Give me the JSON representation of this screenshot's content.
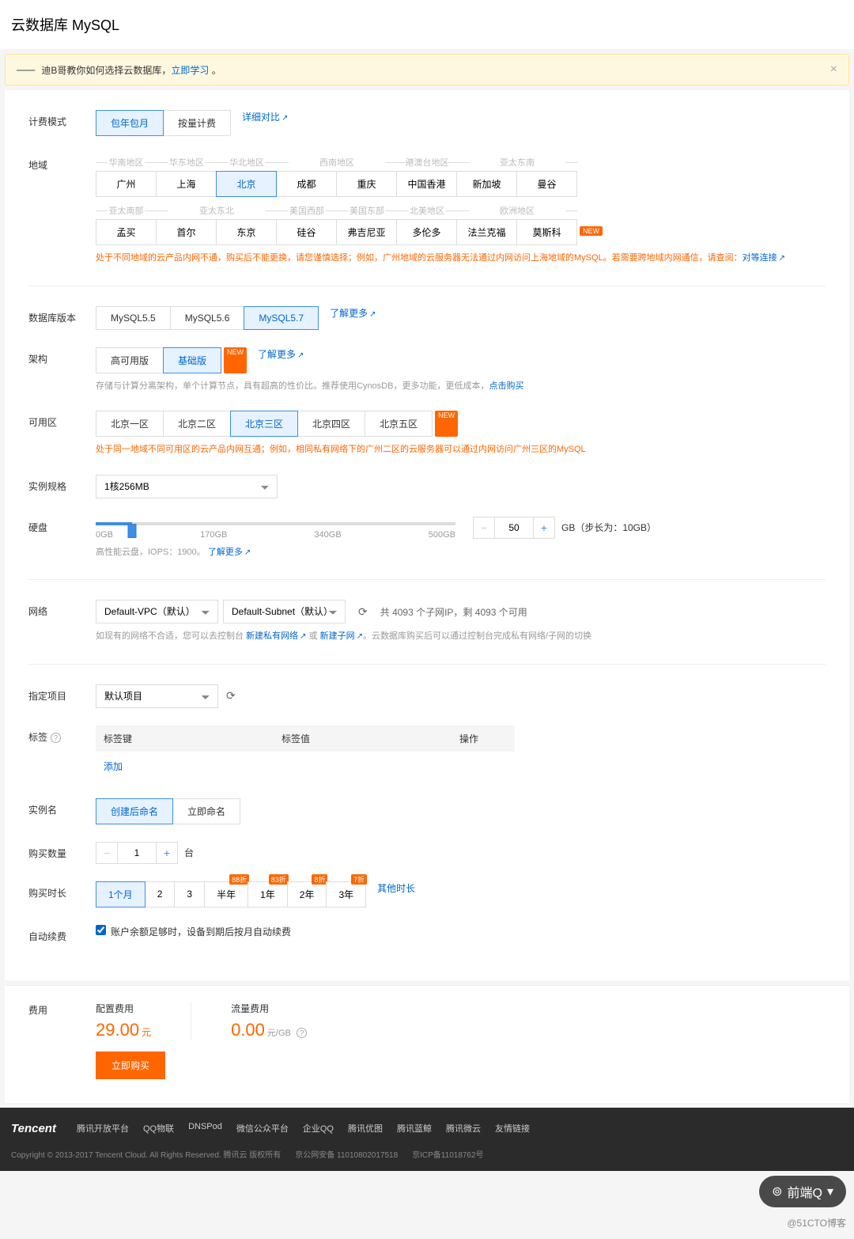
{
  "title": "云数据库 MySQL",
  "alert": {
    "prefix": "迪B哥教你如何选择云数据库，",
    "link": "立即学习",
    "suffix": " 。"
  },
  "billing": {
    "label": "计费模式",
    "opts": [
      "包年包月",
      "按量计费"
    ],
    "detail": "详细对比"
  },
  "region": {
    "label": "地域",
    "groups1": [
      {
        "name": "华南地区",
        "items": [
          "广州"
        ]
      },
      {
        "name": "华东地区",
        "items": [
          "上海"
        ]
      },
      {
        "name": "华北地区",
        "items": [
          "北京"
        ]
      },
      {
        "name": "西南地区",
        "items": [
          "成都",
          "重庆"
        ]
      },
      {
        "name": "港澳台地区",
        "items": [
          "中国香港"
        ]
      },
      {
        "name": "亚太东南",
        "items": [
          "新加坡",
          "曼谷"
        ]
      }
    ],
    "groups2": [
      {
        "name": "亚太南部",
        "items": [
          "孟买"
        ]
      },
      {
        "name": "亚太东北",
        "items": [
          "首尔",
          "东京"
        ]
      },
      {
        "name": "美国西部",
        "items": [
          "硅谷"
        ]
      },
      {
        "name": "美国东部",
        "items": [
          "弗吉尼亚"
        ]
      },
      {
        "name": "北美地区",
        "items": [
          "多伦多"
        ]
      },
      {
        "name": "欧洲地区",
        "items": [
          "法兰克福",
          "莫斯科"
        ]
      }
    ],
    "new_after_moscow": "NEW",
    "active": "北京",
    "warn": "处于不同地域的云产品内网不通，购买后不能更换，请您谨慎选择；例如，广州地域的云服务器无法通过内网访问上海地域的MySQL。若需要跨地域内网通信，请查阅：",
    "warn_link": "对等连接"
  },
  "dbver": {
    "label": "数据库版本",
    "opts": [
      "MySQL5.5",
      "MySQL5.6",
      "MySQL5.7"
    ],
    "active": "MySQL5.7",
    "more": "了解更多"
  },
  "arch": {
    "label": "架构",
    "opts": [
      "高可用版",
      "基础版"
    ],
    "active": "基础版",
    "new": "NEW",
    "more": "了解更多",
    "desc": "存储与计算分离架构，单个计算节点，具有超高的性价比。推荐使用CynosDB，更多功能，更低成本，",
    "desc_link": "点击购买"
  },
  "zone": {
    "label": "可用区",
    "opts": [
      "北京一区",
      "北京二区",
      "北京三区",
      "北京四区",
      "北京五区"
    ],
    "active": "北京三区",
    "new_on": "北京五区",
    "warn": "处于同一地域不同可用区的云产品内网互通；例如，相同私有网络下的广州二区的云服务器可以通过内网访问广州三区的MySQL"
  },
  "spec": {
    "label": "实例规格",
    "value": "1核256MB"
  },
  "disk": {
    "label": "硬盘",
    "ticks": [
      "0GB",
      "170GB",
      "340GB",
      "500GB"
    ],
    "value": "50",
    "unit": "GB（步长为：10GB）",
    "desc": "高性能云盘，IOPS：1900。",
    "more": "了解更多"
  },
  "network": {
    "label": "网络",
    "vpc": "Default-VPC（默认）",
    "subnet": "Default-Subnet（默认）",
    "info": "共 4093 个子网IP，剩 4093 个可用",
    "desc": "如现有的网络不合适，您可以去控制台 ",
    "link1": "新建私有网络",
    "mid": " 或 ",
    "link2": "新建子网",
    "tail": "。云数据库购买后可以通过控制台完成私有网络/子网的切换"
  },
  "project": {
    "label": "指定项目",
    "value": "默认项目"
  },
  "tags": {
    "label": "标签",
    "cols": [
      "标签键",
      "标签值",
      "操作"
    ],
    "add": "添加"
  },
  "instname": {
    "label": "实例名",
    "opts": [
      "创建后命名",
      "立即命名"
    ],
    "active": "创建后命名"
  },
  "qty": {
    "label": "购买数量",
    "value": "1",
    "unit": "台"
  },
  "duration": {
    "label": "购买时长",
    "opts": [
      {
        "t": "1个月"
      },
      {
        "t": "2"
      },
      {
        "t": "3"
      },
      {
        "t": "半年",
        "d": "88折"
      },
      {
        "t": "1年",
        "d": "83折"
      },
      {
        "t": "2年",
        "d": "8折"
      },
      {
        "t": "3年",
        "d": "7折"
      }
    ],
    "other": "其他时长",
    "active": "1个月"
  },
  "renew": {
    "label": "自动续费",
    "text": "账户余额足够时，设备到期后按月自动续费"
  },
  "cost": {
    "label": "费用",
    "config_t": "配置费用",
    "config_v": "29.00",
    "config_u": "元",
    "traffic_t": "流量费用",
    "traffic_v": "0.00",
    "traffic_u": "元/GB",
    "buy": "立即购买"
  },
  "footer": {
    "brand": "Tencent",
    "links": [
      "腾讯开放平台",
      "QQ物联",
      "DNSPod",
      "微信公众平台",
      "企业QQ",
      "腾讯优图",
      "腾讯蓝鲸",
      "腾讯微云",
      "友情链接"
    ],
    "copy": "Copyright © 2013-2017 Tencent Cloud. All Rights Reserved. 腾讯云 版权所有",
    "icp1": "京公网安备 11010802017518",
    "icp2": "京ICP备11018762号"
  },
  "widget": "前端Q",
  "watermark": "@51CTO博客"
}
